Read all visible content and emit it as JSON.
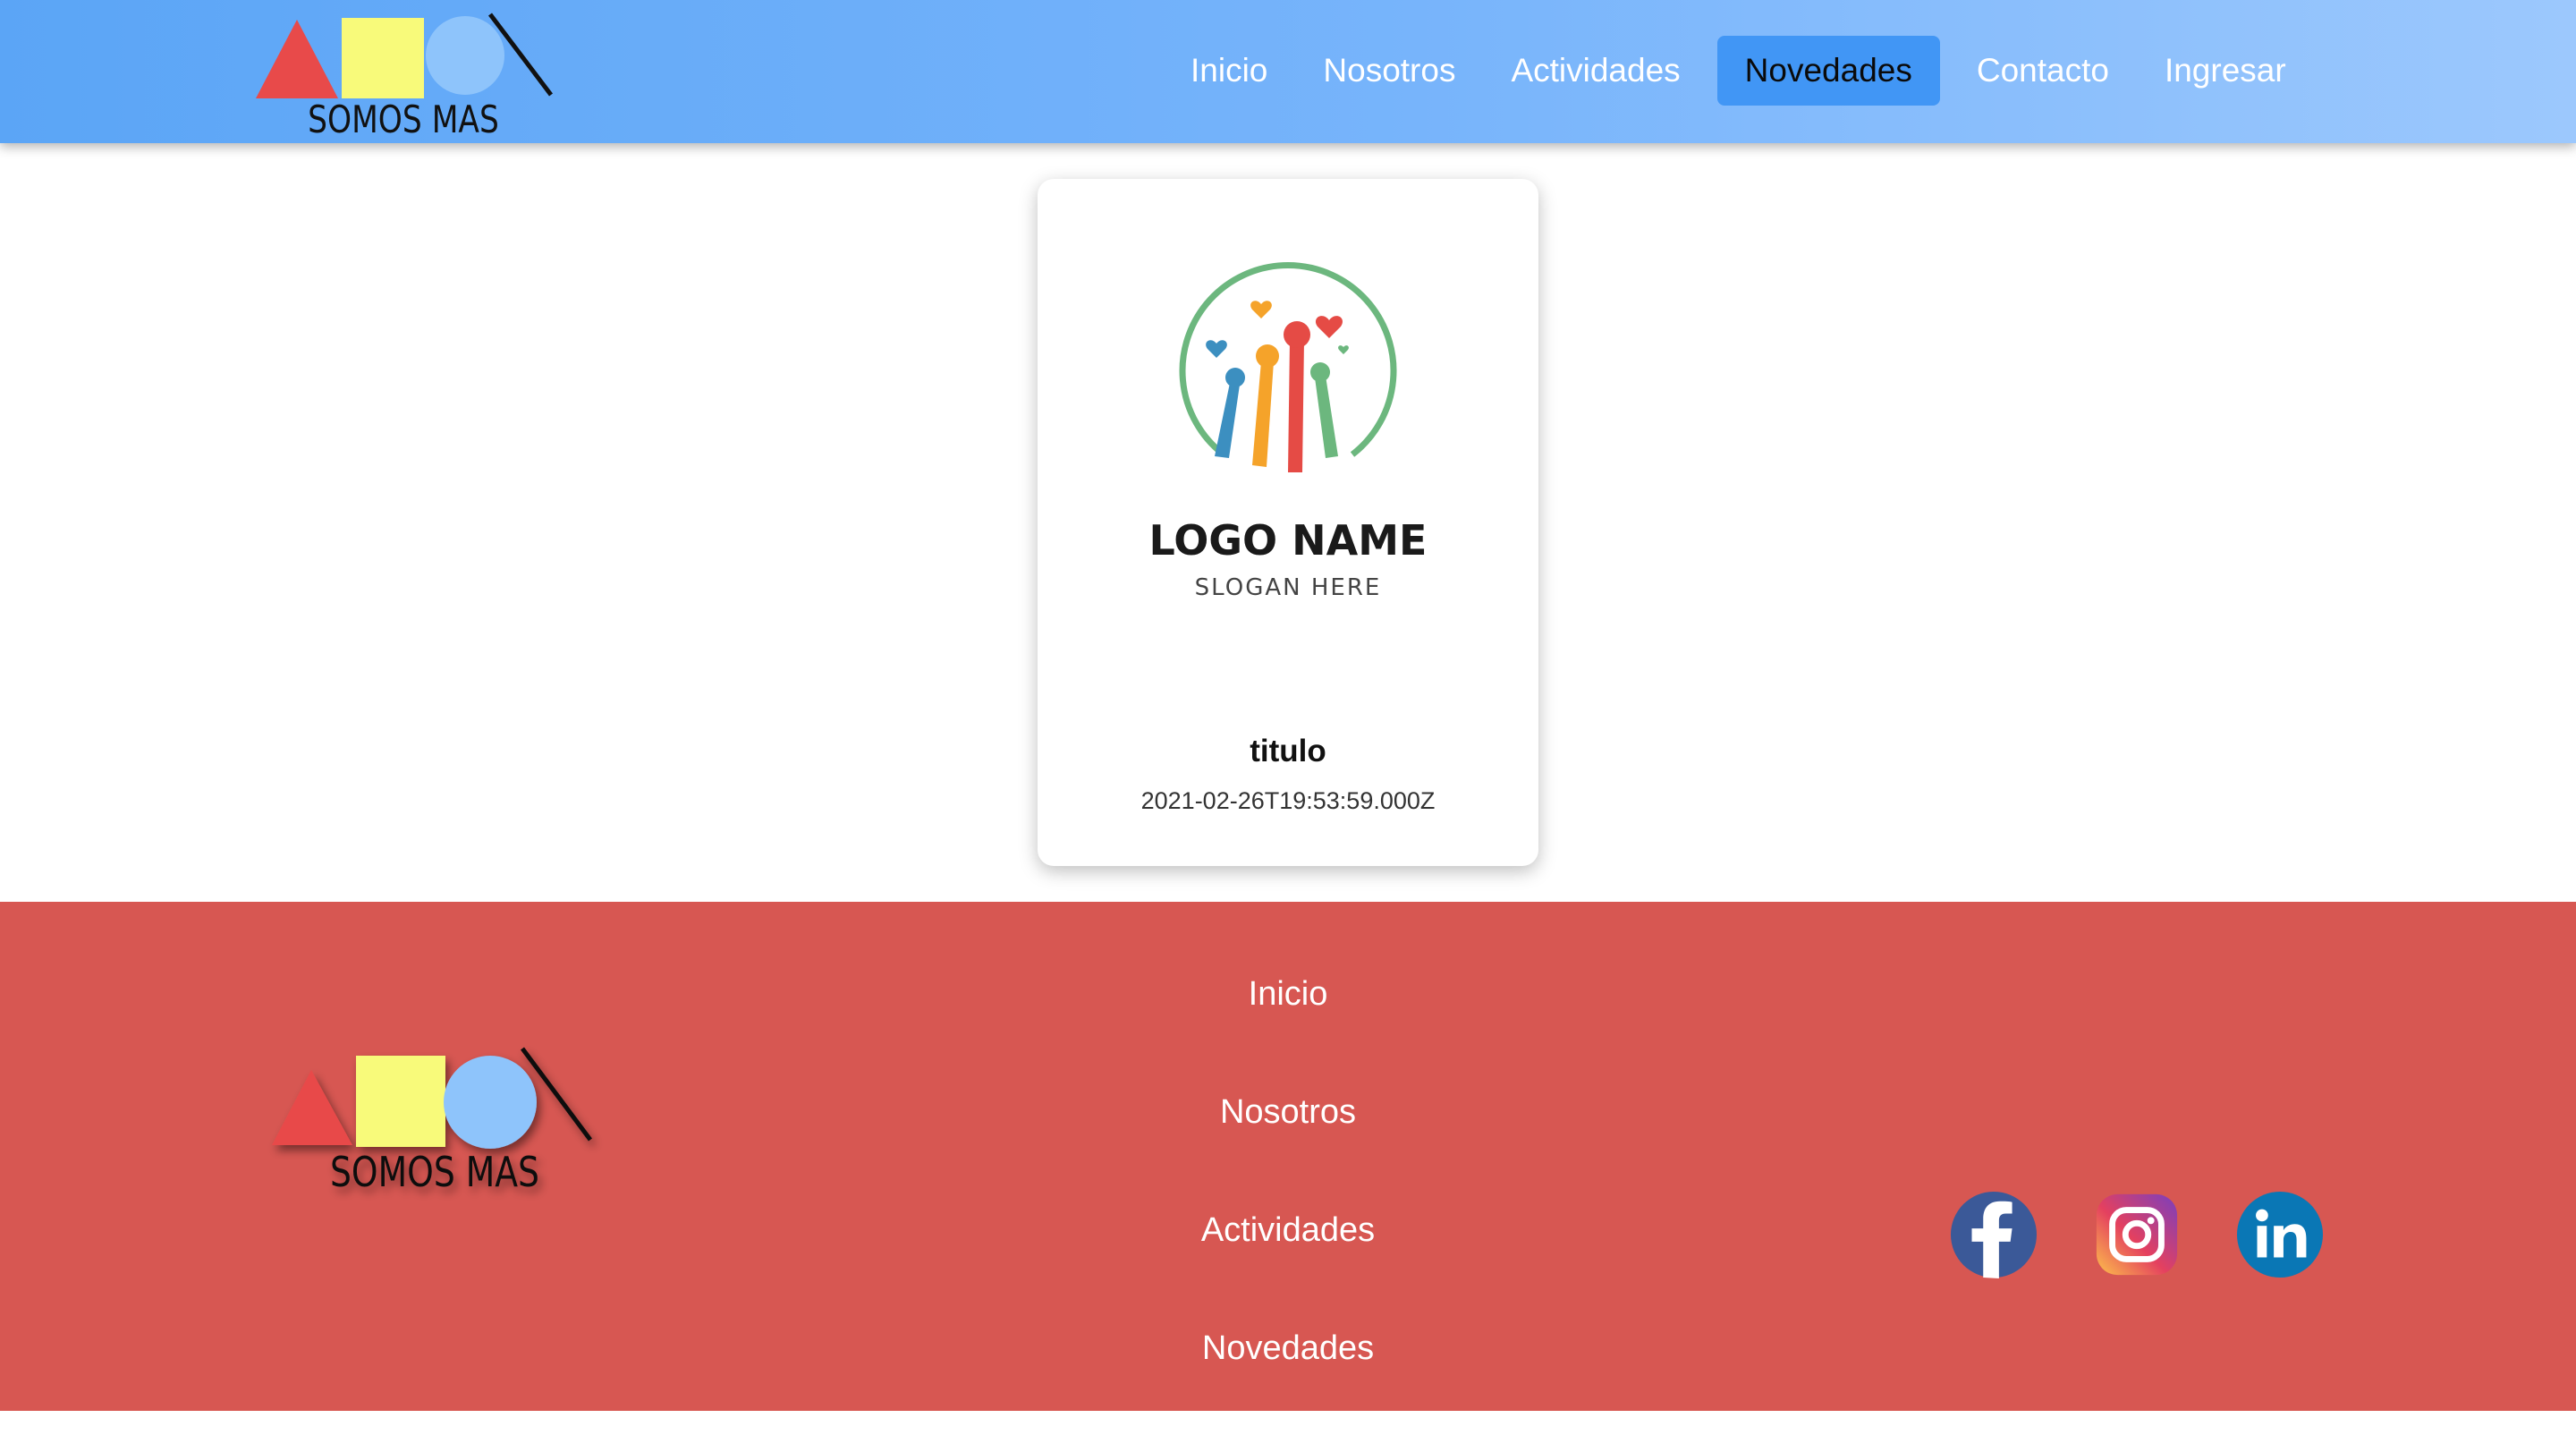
{
  "header": {
    "logo_text": "SOMOS MAS",
    "nav": [
      {
        "label": "Inicio",
        "active": false
      },
      {
        "label": "Nosotros",
        "active": false
      },
      {
        "label": "Actividades",
        "active": false
      },
      {
        "label": "Novedades",
        "active": true
      },
      {
        "label": "Contacto",
        "active": false
      },
      {
        "label": "Ingresar",
        "active": false
      }
    ]
  },
  "news_card": {
    "image_text": {
      "name": "LOGO NAME",
      "slogan": "SLOGAN HERE"
    },
    "title": "titulo",
    "date": "2021-02-26T19:53:59.000Z"
  },
  "footer": {
    "logo_text": "SOMOS MAS",
    "links": [
      "Inicio",
      "Nosotros",
      "Actividades",
      "Novedades"
    ],
    "socials": [
      "facebook-icon",
      "instagram-icon",
      "linkedin-icon"
    ]
  },
  "colors": {
    "header_gradient_start": "#5ba5f6",
    "header_gradient_end": "#9cc8fd",
    "active_nav": "#4196f5",
    "footer_bg": "#d75752",
    "logo_red": "#e84a4a",
    "logo_yellow": "#f8fa7a",
    "logo_blue": "#8ec4fb"
  }
}
